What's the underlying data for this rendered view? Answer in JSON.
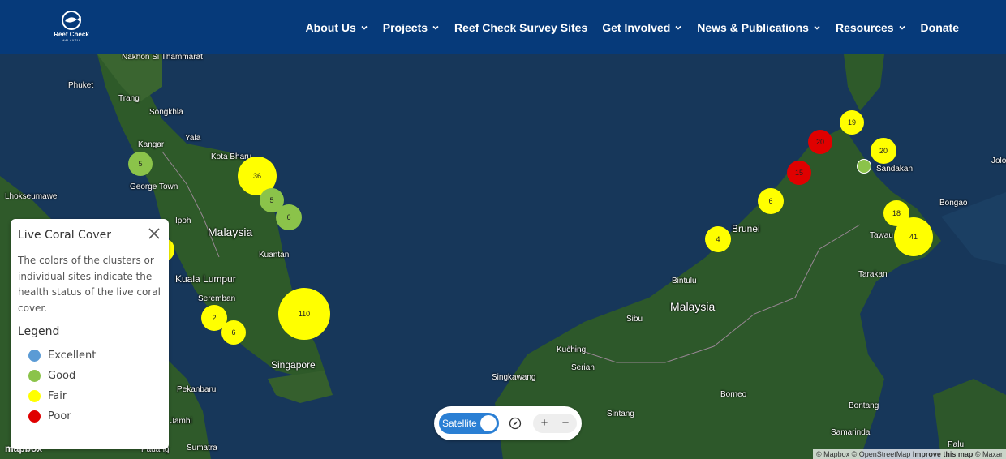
{
  "header": {
    "logo_text": "Reef Check",
    "logo_sub": "MALAYSIA",
    "nav": [
      {
        "label": "About Us",
        "dropdown": true
      },
      {
        "label": "Projects",
        "dropdown": true
      },
      {
        "label": "Reef Check Survey Sites",
        "dropdown": false
      },
      {
        "label": "Get Involved",
        "dropdown": true
      },
      {
        "label": "News & Publications",
        "dropdown": true
      },
      {
        "label": "Resources",
        "dropdown": true
      },
      {
        "label": "Donate",
        "dropdown": false
      }
    ]
  },
  "map": {
    "places": [
      "Nakhon Si Thammarat",
      "Phuket",
      "Trang",
      "Songkhla",
      "Yala",
      "Kangar",
      "Kota Bharu",
      "George Town",
      "Lhokseumawe",
      "Ipoh",
      "Malaysia",
      "Kuantan",
      "Kuala Lumpur",
      "Seremban",
      "Singapore",
      "Pekanbaru",
      "Jambi",
      "Sumatra",
      "Padang",
      "Brunei",
      "Bintulu",
      "Malaysia",
      "Sibu",
      "Kuching",
      "Serian",
      "Singkawang",
      "Sintang",
      "Borneo",
      "Sandakan",
      "Tawau",
      "Tarakan",
      "Bongao",
      "Jolo",
      "Bontang",
      "Samarinda",
      "Palu"
    ],
    "clusters": [
      {
        "count": "5",
        "status": "Good"
      },
      {
        "count": "36",
        "status": "Fair"
      },
      {
        "count": "5",
        "status": "Good"
      },
      {
        "count": "6",
        "status": "Good"
      },
      {
        "count": "110",
        "status": "Fair"
      },
      {
        "count": "2",
        "status": "Fair"
      },
      {
        "count": "6",
        "status": "Fair"
      },
      {
        "count": "",
        "status": "Fair"
      },
      {
        "count": "19",
        "status": "Fair"
      },
      {
        "count": "20",
        "status": "Poor"
      },
      {
        "count": "20",
        "status": "Fair"
      },
      {
        "count": "15",
        "status": "Poor"
      },
      {
        "count": "",
        "status": "Good"
      },
      {
        "count": "6",
        "status": "Fair"
      },
      {
        "count": "4",
        "status": "Fair"
      },
      {
        "count": "18",
        "status": "Fair"
      },
      {
        "count": "41",
        "status": "Fair"
      }
    ]
  },
  "legend_panel": {
    "title": "Live Coral Cover",
    "description": "The colors of the clusters or individual sites indicate the health status of the live coral cover.",
    "legend_title": "Legend",
    "items": [
      {
        "label": "Excellent",
        "color": "#5b9bd5"
      },
      {
        "label": "Good",
        "color": "#8bc34a"
      },
      {
        "label": "Fair",
        "color": "#ffff00"
      },
      {
        "label": "Poor",
        "color": "#e00000"
      }
    ]
  },
  "controls": {
    "toggle_label": "Satellite",
    "zoom_in": "+",
    "zoom_out": "−"
  },
  "attribution": {
    "mapbox": "© Mapbox",
    "osm": "© OpenStreetMap",
    "improve": "Improve this map",
    "maxar": "© Maxar"
  },
  "mapbox_logo": "mapbox",
  "colors": {
    "header_bg": "#063a7a",
    "fair": "#ffff00",
    "good": "#8bc34a",
    "poor": "#e00000",
    "toggle": "#2a7fd4"
  }
}
